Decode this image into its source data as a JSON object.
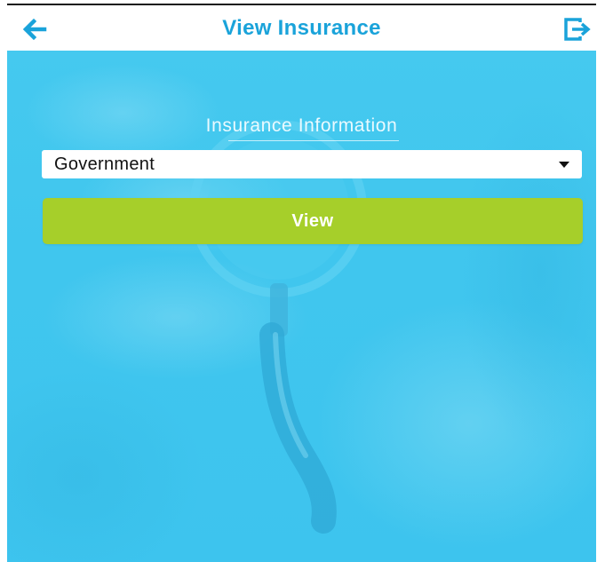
{
  "header": {
    "title": "View Insurance",
    "back_icon": "arrow-left-icon",
    "logout_icon": "logout-icon",
    "accent_color": "#1aa3da"
  },
  "main": {
    "section_title": "Insurance Information",
    "insurance_type": {
      "selected": "Government"
    },
    "view_button": {
      "label": "View",
      "color": "#a6cf2a"
    },
    "background_color": "#40c6ee"
  }
}
